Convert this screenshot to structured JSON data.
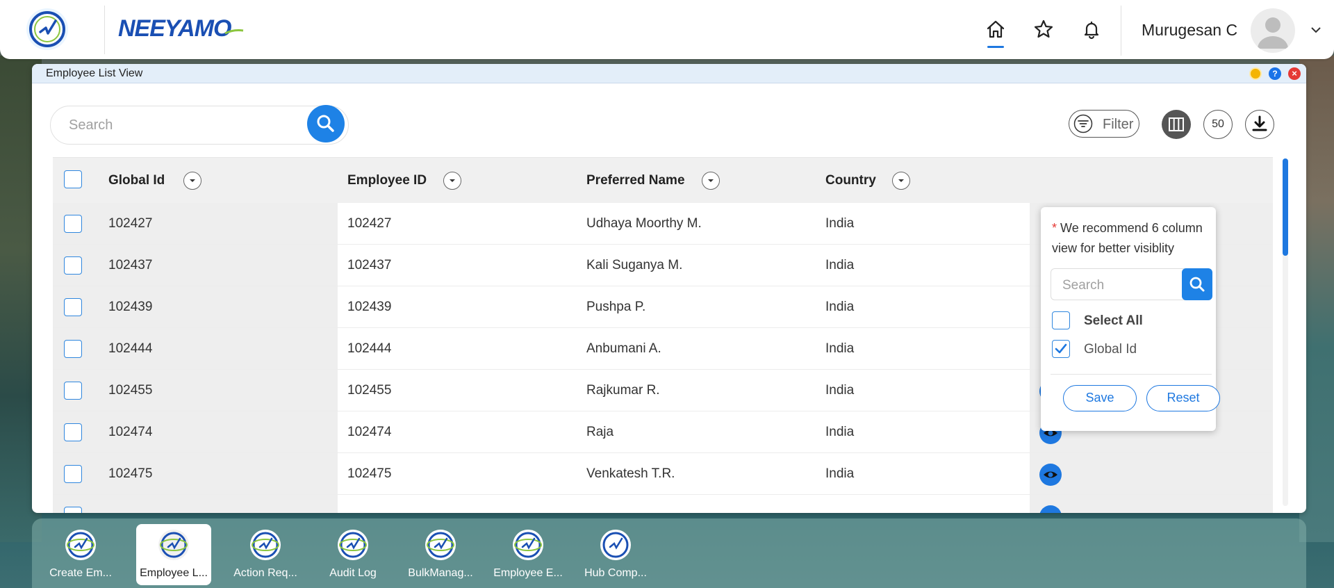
{
  "header": {
    "brand": "NEEYAMO",
    "user_name": "Murugesan C",
    "nav": [
      "home-icon",
      "star-icon",
      "bell-icon"
    ]
  },
  "window": {
    "title": "Employee List View",
    "controls": {
      "help": "?",
      "close": "×"
    }
  },
  "toolbar": {
    "search_placeholder": "Search",
    "filter_label": "Filter",
    "page_size": "50"
  },
  "table": {
    "columns": [
      "Global Id",
      "Employee ID",
      "Preferred Name",
      "Country"
    ],
    "rows": [
      {
        "global_id": "102427",
        "employee_id": "102427",
        "name": "Udhaya Moorthy M.",
        "country": "India"
      },
      {
        "global_id": "102437",
        "employee_id": "102437",
        "name": "Kali Suganya M.",
        "country": "India"
      },
      {
        "global_id": "102439",
        "employee_id": "102439",
        "name": "Pushpa P.",
        "country": "India"
      },
      {
        "global_id": "102444",
        "employee_id": "102444",
        "name": "Anbumani A.",
        "country": "India"
      },
      {
        "global_id": "102455",
        "employee_id": "102455",
        "name": "Rajkumar R.",
        "country": "India"
      },
      {
        "global_id": "102474",
        "employee_id": "102474",
        "name": "Raja",
        "country": "India"
      },
      {
        "global_id": "102475",
        "employee_id": "102475",
        "name": "Venkatesh T.R.",
        "country": "India"
      }
    ]
  },
  "column_chooser": {
    "note_star": "*",
    "note": "We recommend 6 column view for better visiblity",
    "search_placeholder": "Search",
    "items": [
      {
        "label": "Select All",
        "checked": false
      },
      {
        "label": "Global Id",
        "checked": true
      }
    ],
    "save_label": "Save",
    "reset_label": "Reset"
  },
  "taskbar": {
    "items": [
      {
        "label": "Create Em...",
        "active": false
      },
      {
        "label": "Employee L...",
        "active": true
      },
      {
        "label": "Action Req...",
        "active": false
      },
      {
        "label": "Audit Log",
        "active": false
      },
      {
        "label": "BulkManag...",
        "active": false
      },
      {
        "label": "Employee E...",
        "active": false
      },
      {
        "label": "Hub Comp...",
        "active": false
      }
    ]
  },
  "colors": {
    "accent": "#1e78e0",
    "brand": "#1a4fb3",
    "brand_green": "#8cc63f",
    "close": "#e53935",
    "minimize": "#f4b400"
  }
}
